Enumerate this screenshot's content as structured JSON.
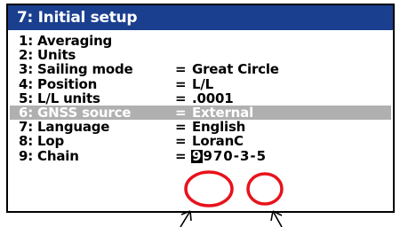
{
  "header": {
    "title": "7: Initial setup"
  },
  "menu": {
    "equals": "=",
    "items": [
      {
        "label": "1: Averaging",
        "value": ""
      },
      {
        "label": "2: Units",
        "value": ""
      },
      {
        "label": "3: Sailing mode",
        "value": "Great Circle"
      },
      {
        "label": "4: Position",
        "value": "L/L"
      },
      {
        "label": "5: L/L units",
        "value": ".0001"
      },
      {
        "label": "6: GNSS source",
        "value": "External",
        "disabled": true
      },
      {
        "label": "7: Language",
        "value": "English"
      },
      {
        "label": "8: Lop",
        "value": "LoranC"
      },
      {
        "label": "9: Chain",
        "cursor_char": "9",
        "value_rest": "970-3-5"
      }
    ]
  },
  "colors": {
    "title_bg": "#1a3f8f",
    "disabled_bg": "#b0b0b0",
    "annotation": "#e8121b"
  }
}
